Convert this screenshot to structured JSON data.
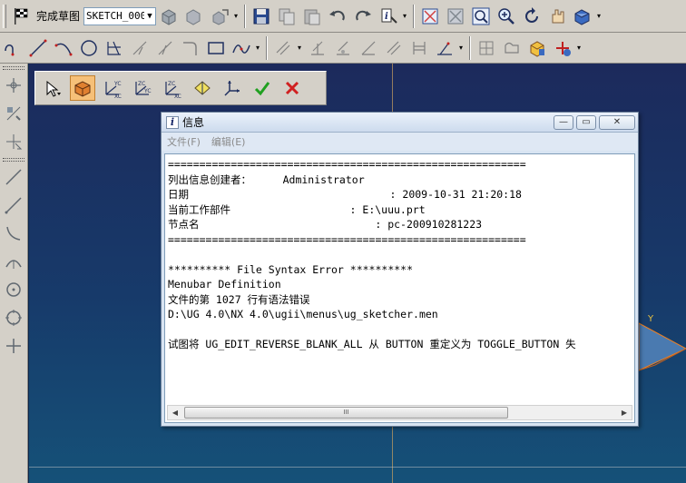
{
  "toolbar_top": {
    "finish_label": "完成草图",
    "sketch_name": "SKETCH_000"
  },
  "info_window": {
    "title": "信息",
    "menu": [
      "文件(F)",
      "编辑(E)"
    ],
    "lines": [
      "=========================================================",
      "列出信息创建者：     Administrator",
      "日期                                : 2009-10-31 21:20:18",
      "当前工作部件                   : E:\\uuu.prt",
      "节点名                            : pc-200910281223",
      "=========================================================",
      "",
      "********** File Syntax Error **********",
      "Menubar Definition",
      "文件的第 1027 行有语法错误",
      "D:\\UG 4.0\\NX 4.0\\ugii\\menus\\ug_sketcher.men",
      "",
      "试图将 UG_EDIT_REVERSE_BLANK_ALL 从 BUTTON 重定义为 TOGGLE_BUTTON 失"
    ],
    "scroll_grip": "III"
  },
  "graphics": {
    "axis_label": "Y"
  },
  "colors": {
    "accept": "#20a020",
    "cancel": "#d02020",
    "bg_top": "#1c2a5c",
    "bg_bottom": "#155178"
  }
}
